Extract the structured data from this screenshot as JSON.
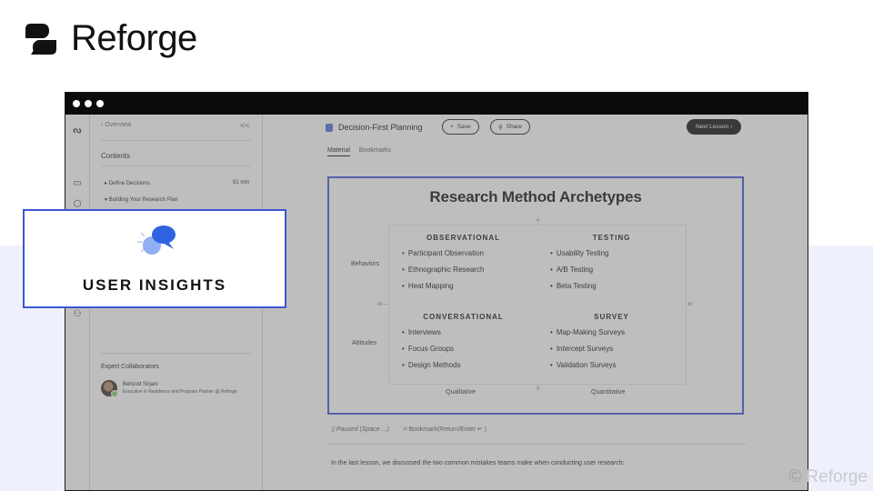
{
  "brand": {
    "name": "Reforge"
  },
  "watermark": "© Reforge",
  "sidebar": {
    "back_label": "Overview",
    "collapse_label": "<<",
    "contents_label": "Contents",
    "items": [
      {
        "label": "Define Decisions",
        "duration": "51 min",
        "marker": "▸"
      },
      {
        "label": "Building Your Research Plan",
        "duration": "",
        "marker": "▾"
      }
    ],
    "experts_title": "Expert Collaborators",
    "expert": {
      "name": "Behzod Sirjani",
      "role": "Executive in Residence and Program Partner @ Reforge"
    }
  },
  "header": {
    "lesson_title": "Decision-First Planning",
    "save_label": "Save",
    "share_label": "Share",
    "next_label": "Next Lesson"
  },
  "tabs": [
    {
      "label": "Material",
      "active": true
    },
    {
      "label": "Bookmarks",
      "active": false
    }
  ],
  "slide": {
    "title": "Research Method Archetypes",
    "row_labels": [
      "Behaviors",
      "Attitudes"
    ],
    "col_labels": [
      "Qualitative",
      "Quantitative"
    ],
    "quadrants": [
      {
        "title": "OBSERVATIONAL",
        "items": [
          "Participant Observation",
          "Ethnographic Research",
          "Heat Mapping"
        ]
      },
      {
        "title": "TESTING",
        "items": [
          "Usability Testing",
          "A/B Testing",
          "Beta Testing"
        ]
      },
      {
        "title": "CONVERSATIONAL",
        "items": [
          "Interviews",
          "Focus Groups",
          "Design Methods"
        ]
      },
      {
        "title": "SURVEY",
        "items": [
          "Map-Making Surveys",
          "Intercept Surveys",
          "Validation Surveys"
        ]
      }
    ]
  },
  "controls": {
    "pause_label": "Paused (Space ...)",
    "bookmark_label": "Bookmark(Return/Enter ↵ )"
  },
  "body": {
    "text": "In the last lesson, we discussed the two common mistakes teams make when conducting user research:"
  },
  "overlay": {
    "label": "USER INSIGHTS"
  },
  "colors": {
    "accent": "#3e56d4",
    "dark": "#0b0b0b",
    "band": "#eef0fb"
  }
}
